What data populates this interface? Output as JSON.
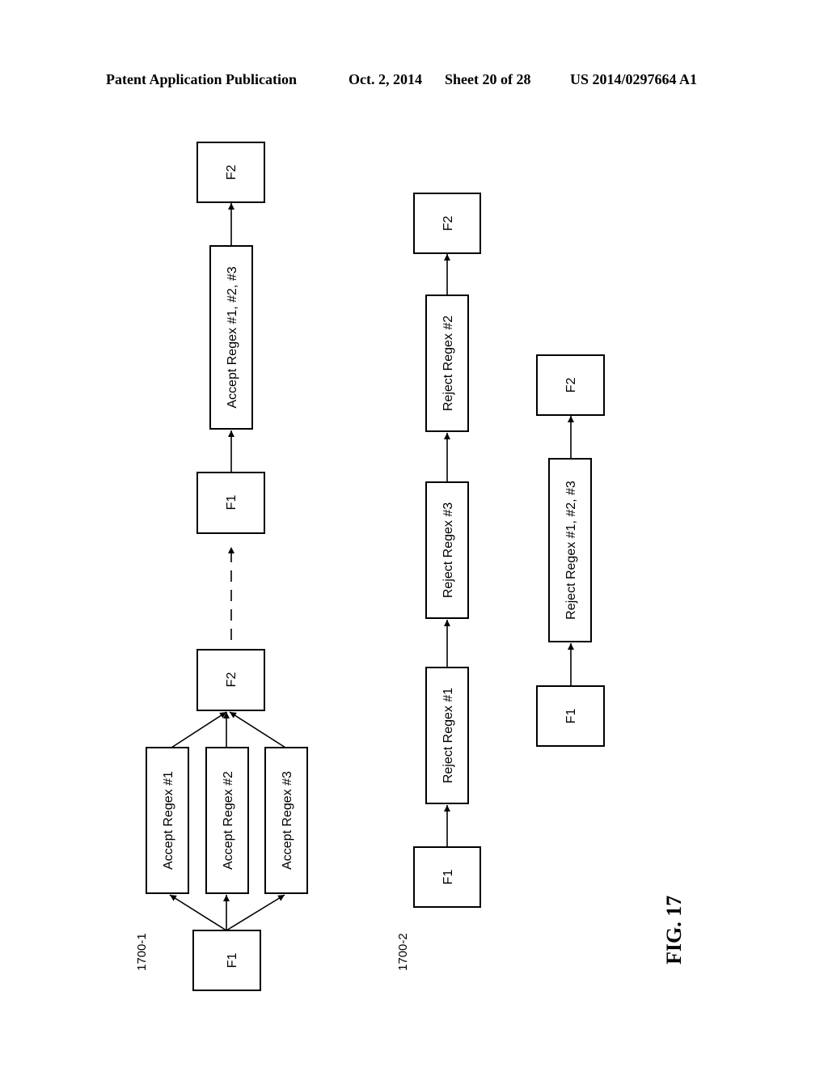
{
  "header": {
    "publication": "Patent Application Publication",
    "date": "Oct. 2, 2014",
    "sheet": "Sheet 20 of 28",
    "patent_number": "US 2014/0297664 A1"
  },
  "figure_label": "FIG. 17",
  "diagrams": [
    {
      "ref": "1700-1",
      "nodes": {
        "f1_start": "F1",
        "accept1": "Accept Regex #1",
        "accept2": "Accept Regex #2",
        "accept3": "Accept Regex #3",
        "f2_mid": "F2",
        "f1_mid": "F1",
        "accept_all": "Accept Regex #1, #2, #3",
        "f2_end": "F2"
      },
      "edges": [
        {
          "from": "f1_start",
          "to": "accept1",
          "style": "solid"
        },
        {
          "from": "f1_start",
          "to": "accept2",
          "style": "solid"
        },
        {
          "from": "f1_start",
          "to": "accept3",
          "style": "solid"
        },
        {
          "from": "accept1",
          "to": "f2_mid",
          "style": "solid"
        },
        {
          "from": "accept2",
          "to": "f2_mid",
          "style": "solid"
        },
        {
          "from": "accept3",
          "to": "f2_mid",
          "style": "solid"
        },
        {
          "from": "f2_mid",
          "to": "f1_mid",
          "style": "dashed"
        },
        {
          "from": "f1_mid",
          "to": "accept_all",
          "style": "solid"
        },
        {
          "from": "accept_all",
          "to": "f2_end",
          "style": "solid"
        }
      ]
    },
    {
      "ref": "1700-2",
      "nodes": {
        "f1": "F1",
        "reject1": "Reject Regex #1",
        "reject3": "Reject Regex #3",
        "reject2": "Reject Regex #2",
        "f2": "F2"
      },
      "edges": [
        {
          "from": "f1",
          "to": "reject1",
          "style": "solid"
        },
        {
          "from": "reject1",
          "to": "reject3",
          "style": "solid"
        },
        {
          "from": "reject3",
          "to": "reject2",
          "style": "solid"
        },
        {
          "from": "reject2",
          "to": "f2",
          "style": "solid"
        }
      ]
    },
    {
      "ref": "",
      "nodes": {
        "f1": "F1",
        "reject_all": "Reject Regex #1, #2, #3",
        "f2": "F2"
      },
      "edges": [
        {
          "from": "f1",
          "to": "reject_all",
          "style": "solid"
        },
        {
          "from": "reject_all",
          "to": "f2",
          "style": "solid"
        }
      ]
    }
  ]
}
